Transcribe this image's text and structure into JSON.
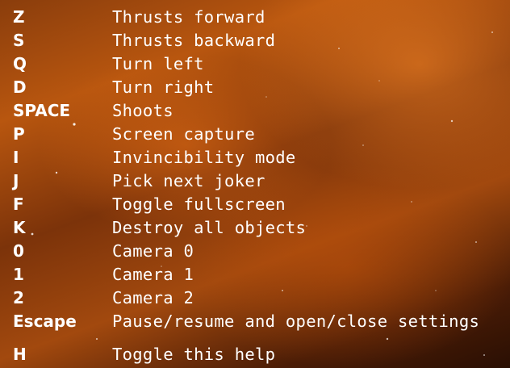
{
  "help": {
    "rows": [
      {
        "key": "Z",
        "action": "Thrusts forward"
      },
      {
        "key": "S",
        "action": "Thrusts backward"
      },
      {
        "key": "Q",
        "action": "Turn left"
      },
      {
        "key": "D",
        "action": "Turn right"
      },
      {
        "key": "SPACE",
        "action": "Shoots"
      },
      {
        "key": "P",
        "action": "Screen capture"
      },
      {
        "key": "I",
        "action": "Invincibility mode"
      },
      {
        "key": "J",
        "action": "Pick next joker"
      },
      {
        "key": "F",
        "action": "Toggle fullscreen"
      },
      {
        "key": "K",
        "action": "Destroy all objects"
      },
      {
        "key": "0",
        "action": "Camera 0"
      },
      {
        "key": "1",
        "action": "Camera 1"
      },
      {
        "key": "2",
        "action": "Camera 2"
      },
      {
        "key": "Escape",
        "action": "Pause/resume and open/close settings"
      },
      {
        "key": "H",
        "action": "Toggle this help"
      }
    ]
  },
  "colors": {
    "text": "#ffffff",
    "nebula": "#b8560f",
    "space": "#2a0f03"
  }
}
